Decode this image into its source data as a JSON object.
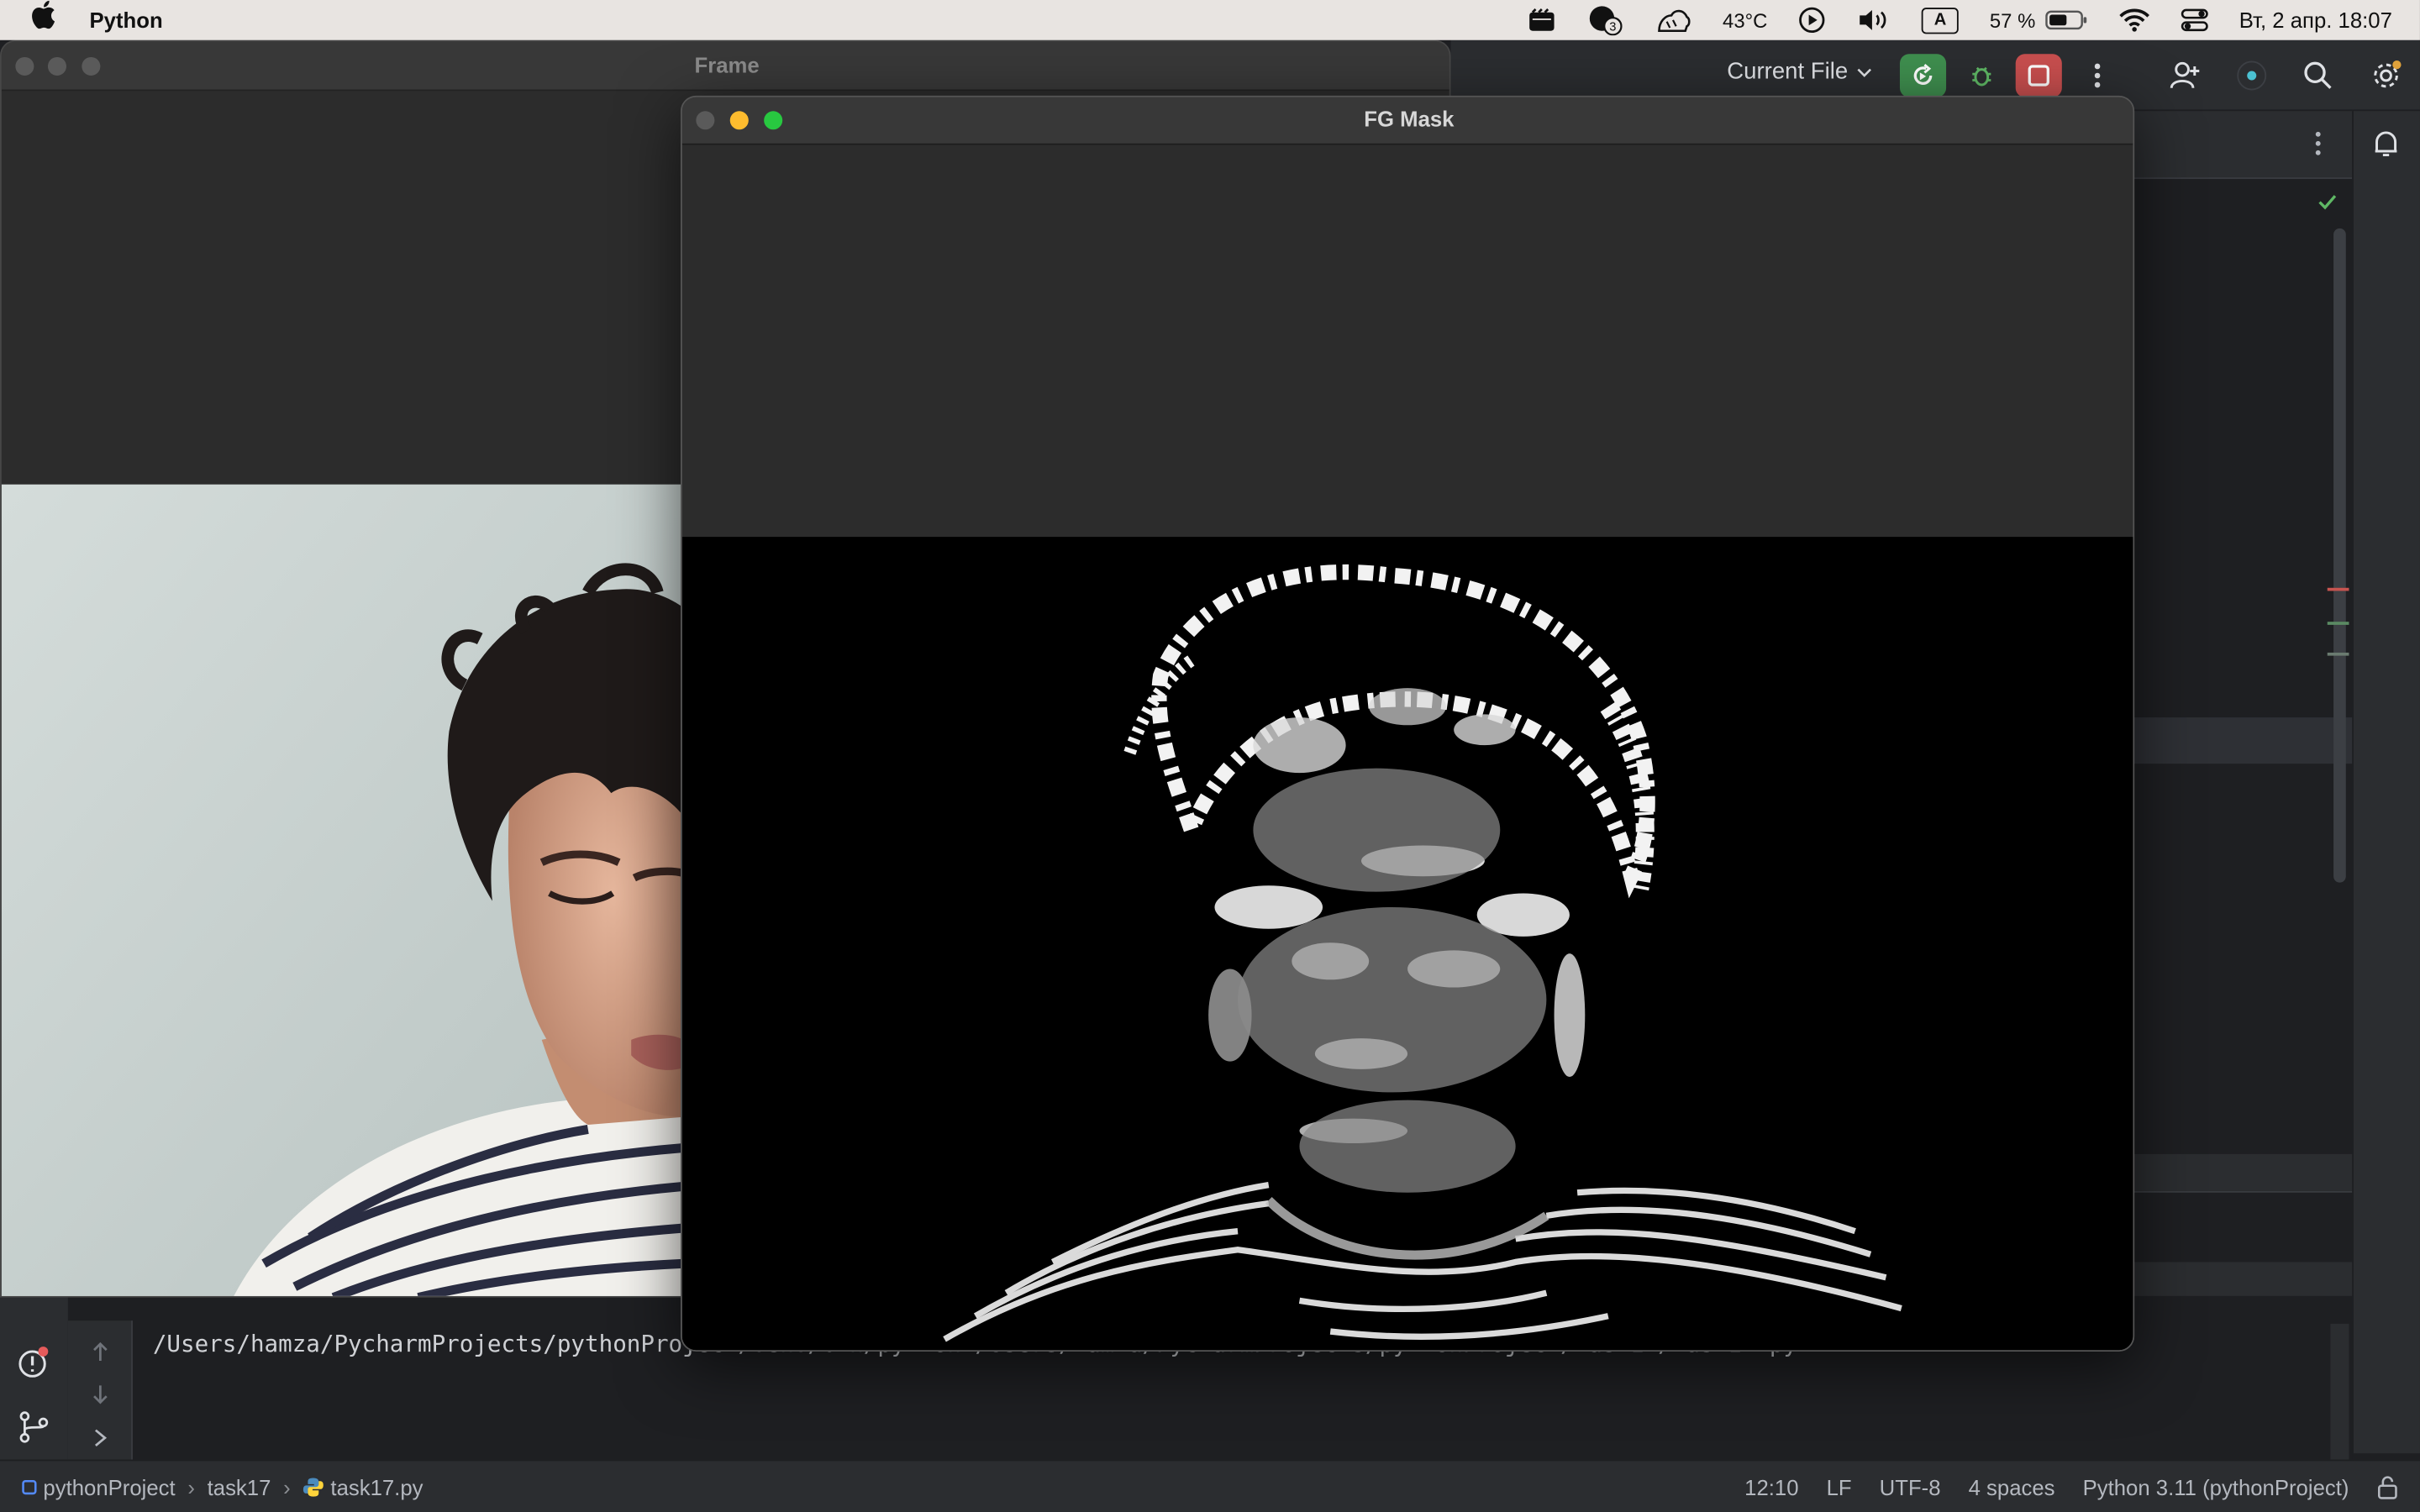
{
  "menubar": {
    "app_name": "Python",
    "temperature": "43°C",
    "keyboard_layout": "A",
    "battery": "57 %",
    "datetime": "Вт, 2 апр.  18:07",
    "notification_count": "3",
    "icons": [
      "apple-icon",
      "clapper-icon",
      "chat-icon",
      "weather-icon",
      "play-icon",
      "volume-icon",
      "battery-icon",
      "wifi-icon",
      "control-center-icon"
    ]
  },
  "frame_window": {
    "title": "Frame",
    "traffic_lights_color": "#5a5a5a"
  },
  "fg_window": {
    "title": "FG Mask",
    "traffic_lights": [
      "#5a5a5a",
      "#febc2e",
      "#28c840"
    ]
  },
  "toolbar": {
    "run_config": "Current File",
    "run_color": "#3f8f4f",
    "stop_color": "#c94f4f"
  },
  "console": {
    "command_visible": "/Users/hamza/PycharmProjects/pythonProject/venv/bin/python /Users/hamza/PycharmProjects/pythonProject/task17/task17.py"
  },
  "statusbar": {
    "breadcrumb": [
      "pythonProject",
      "task17",
      "task17.py"
    ],
    "position": "12:10",
    "line_ending": "LF",
    "encoding": "UTF-8",
    "indent": "4 spaces",
    "interpreter": "Python 3.11 (pythonProject)"
  }
}
